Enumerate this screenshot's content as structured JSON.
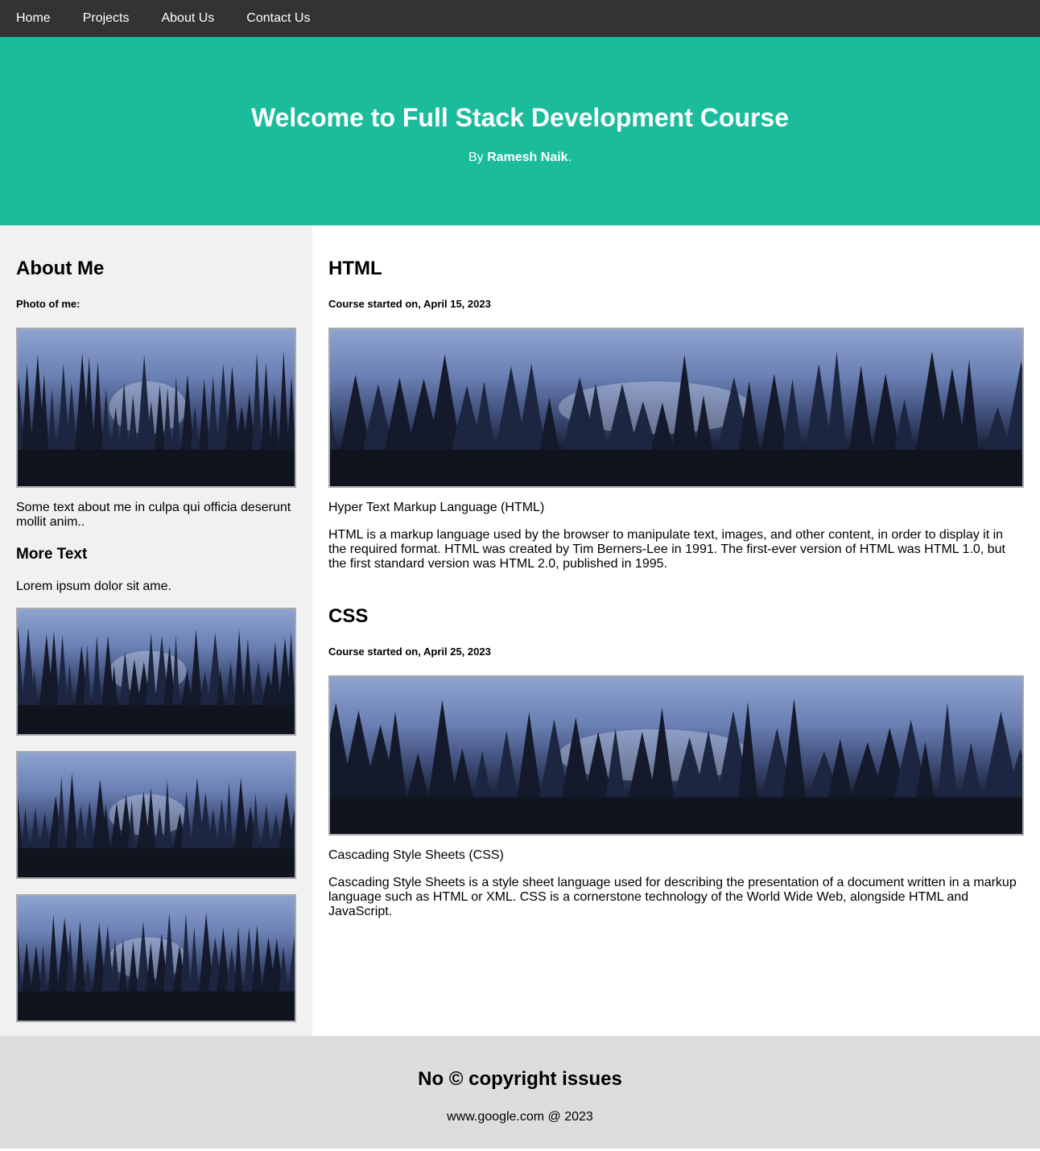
{
  "nav": {
    "items": [
      "Home",
      "Projects",
      "About Us",
      "Contact Us"
    ]
  },
  "hero": {
    "title": "Welcome to Full Stack Development Course",
    "byline_prefix": "By ",
    "author": "Ramesh Naik",
    "byline_suffix": "."
  },
  "sidebar": {
    "heading": "About Me",
    "photo_label": "Photo of me:",
    "about_text": "Some text about me in culpa qui officia deserunt mollit anim..",
    "more_heading": "More Text",
    "more_text": "Lorem ipsum dolor sit ame."
  },
  "main": {
    "sections": [
      {
        "title": "HTML",
        "date": "Course started on, April 15, 2023",
        "caption": "Hyper Text Markup Language (HTML)",
        "body": "HTML is a markup language used by the browser to manipulate text, images, and other content, in order to display it in the required format. HTML was created by Tim Berners-Lee in 1991. The first-ever version of HTML was HTML 1.0, but the first standard version was HTML 2.0, published in 1995."
      },
      {
        "title": "CSS",
        "date": "Course started on, April 25, 2023",
        "caption": "Cascading Style Sheets (CSS)",
        "body": "Cascading Style Sheets is a style sheet language used for describing the presentation of a document written in a markup language such as HTML or XML. CSS is a cornerstone technology of the World Wide Web, alongside HTML and JavaScript."
      }
    ]
  },
  "footer": {
    "heading": "No © copyright issues",
    "text": "www.google.com @ 2023"
  },
  "colors": {
    "nav_bg": "#333333",
    "hero_bg": "#1abc9c",
    "sidebar_bg": "#f1f1f1",
    "footer_bg": "#dddddd"
  }
}
